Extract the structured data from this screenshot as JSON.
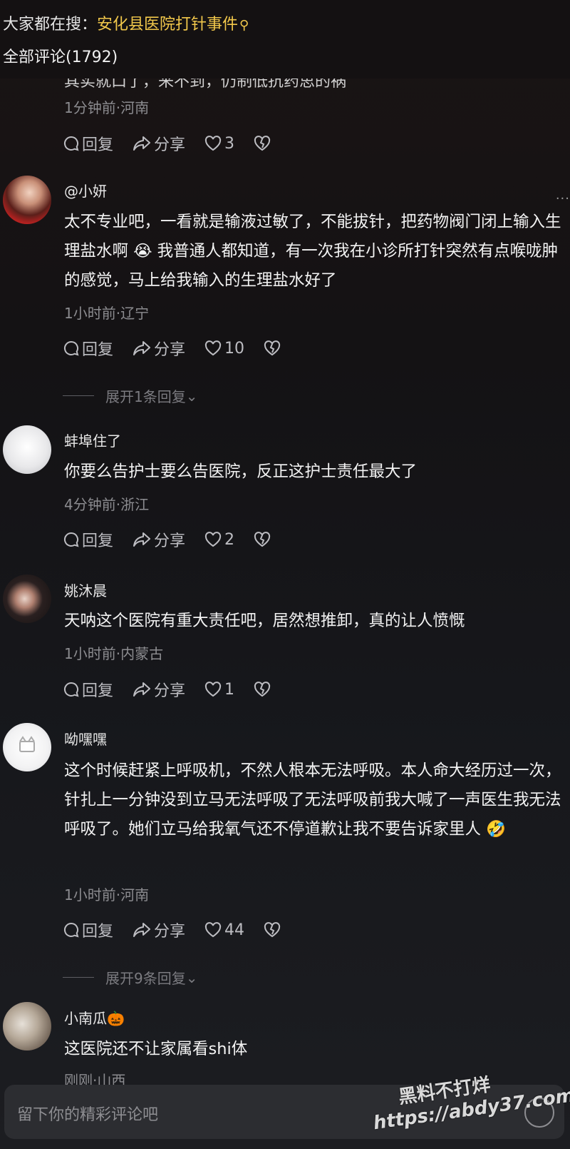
{
  "header": {
    "search_prefix": "大家都在搜：",
    "search_hot_term": "安化县医院打针事件",
    "comments_count_label": "全部评论(1792)"
  },
  "partial_comment": {
    "text_fragment": "其实就口了，来不到，仍制低抗药思的祸",
    "meta": "1分钟前·河南",
    "reply": "回复",
    "share": "分享",
    "likes": "3"
  },
  "comments": [
    {
      "username": "@小妍",
      "text": "太不专业吧，一看就是输液过敏了，不能拔针，把药物阀门闭上输入生理盐水啊 😭 我普通人都知道，有一次我在小诊所打针突然有点喉咙肿的感觉，马上给我输入的生理盐水好了",
      "meta": "1小时前·辽宁",
      "reply": "回复",
      "share": "分享",
      "likes": "10",
      "expand": "展开1条回复"
    },
    {
      "username": "蚌埠住了",
      "text": "你要么告护士要么告医院，反正这护士责任最大了",
      "meta": "4分钟前·浙江",
      "reply": "回复",
      "share": "分享",
      "likes": "2"
    },
    {
      "username": "姚沐晨",
      "text": "天呐这个医院有重大责任吧，居然想推卸，真的让人愤慨",
      "meta": "1小时前·内蒙古",
      "reply": "回复",
      "share": "分享",
      "likes": "1"
    },
    {
      "username": "呦嘿嘿",
      "text": "这个时候赶紧上呼吸机，不然人根本无法呼吸。本人命大经历过一次，针扎上一分钟没到立马无法呼吸了无法呼吸前我大喊了一声医生我无法呼吸了。她们立马给我氧气还不停道歉让我不要告诉家里人 🤣",
      "meta": "1小时前·河南",
      "reply": "回复",
      "share": "分享",
      "likes": "44",
      "expand": "展开9条回复"
    },
    {
      "username": "小南瓜",
      "username_badge": "🎃",
      "text": "这医院还不让家属看shi体",
      "meta": "刚刚·山西"
    }
  ],
  "input": {
    "placeholder": "留下你的精彩评论吧"
  },
  "watermark": {
    "line1": "黑料不打烊",
    "line2": "https://abdy37.com"
  },
  "colors": {
    "hot_search": "#f2c84b",
    "meta_gray": "#8c8c90",
    "background": "#141214"
  },
  "icons": [
    "comment-icon",
    "share-icon",
    "heart-icon",
    "dislike-icon",
    "search-icon",
    "emoji-icon"
  ]
}
